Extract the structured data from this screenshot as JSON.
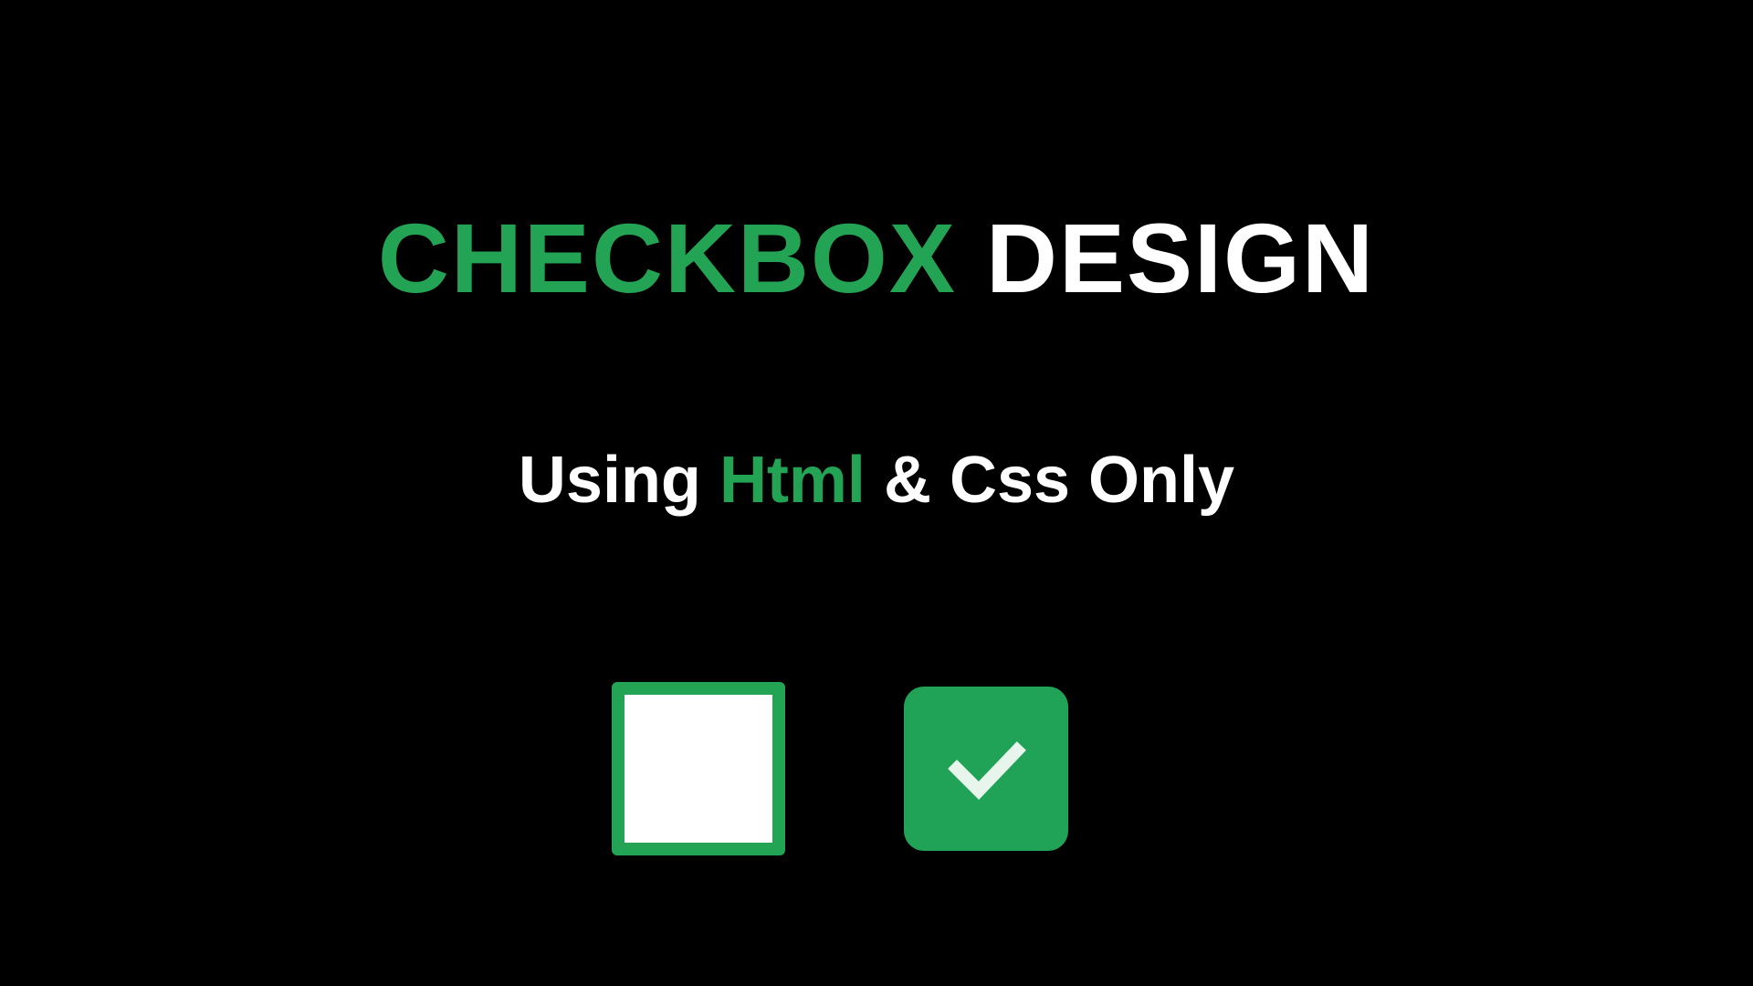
{
  "title": {
    "part1": "CHECKBOX",
    "part2": "DESIGN"
  },
  "subtitle": {
    "part1": "Using",
    "part2": "Html",
    "part3": "& Css Only"
  },
  "checkboxes": {
    "unchecked": {
      "state": "unchecked"
    },
    "checked": {
      "state": "checked"
    }
  },
  "colors": {
    "accent": "#23A455",
    "background": "#000000",
    "text": "#FFFFFF"
  }
}
